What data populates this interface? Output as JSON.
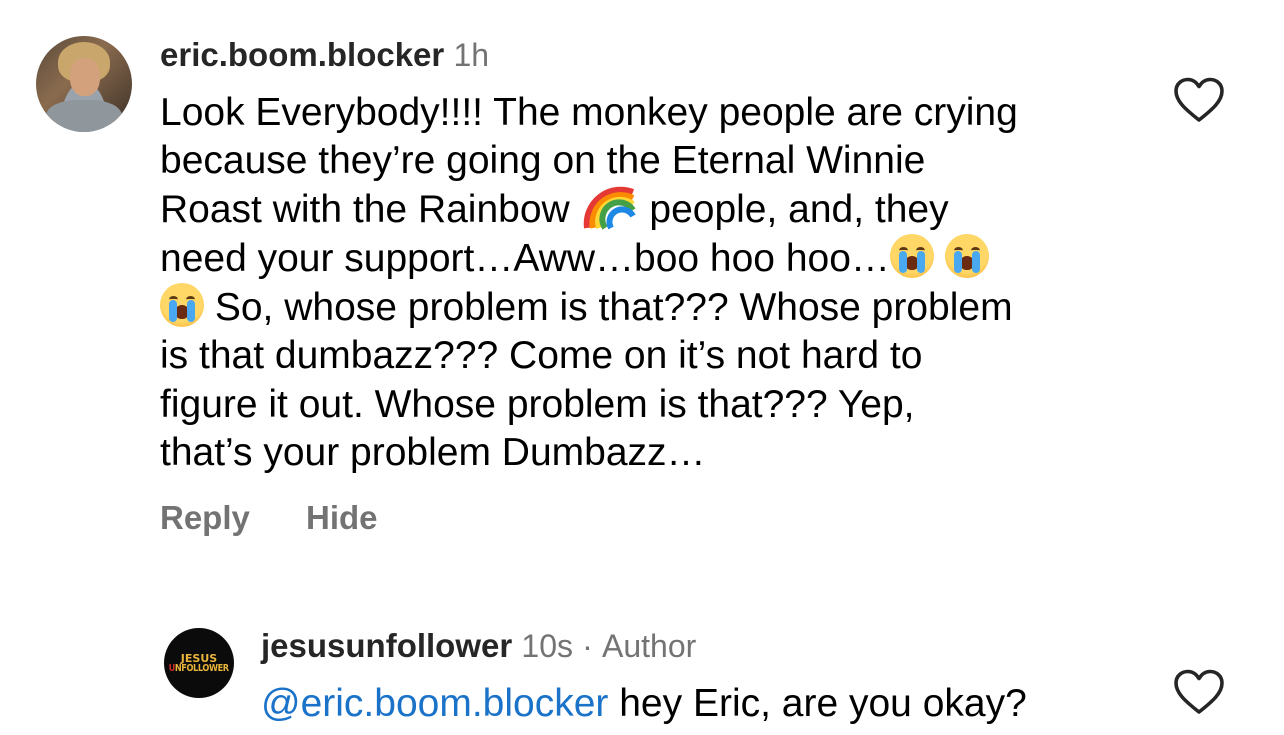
{
  "comments": [
    {
      "username": "eric.boom.blocker",
      "time": "1h",
      "lines": [
        "Look Everybody!!!! The monkey people are crying",
        "because they’re going on the Eternal Winnie",
        [
          "Roast with the Rainbow ",
          " people, and, they"
        ],
        "need your support…Aww…boo hoo hoo…",
        " So, whose problem is that??? Whose problem",
        "is that dumbazz??? Come on it’s not hard to",
        "figure it out. Whose problem is that??? Yep,",
        "that’s your problem Dumbazz…"
      ],
      "actions": {
        "reply": "Reply",
        "hide": "Hide"
      },
      "icons": {
        "avatar": "profile-photo",
        "like": "heart-outline-icon",
        "rainbow": "rainbow-emoji",
        "cry": "loudly-crying-face-emoji"
      }
    },
    {
      "username": "jesusunfollower",
      "time": "10s",
      "separator": "·",
      "badge": "Author",
      "mention": "@eric.boom.blocker",
      "text": " hey Eric, are you okay?",
      "avatar_logo": {
        "top": "JESUS",
        "bottom_first": "U",
        "bottom_rest": "NFOLLOWER"
      },
      "icons": {
        "like": "heart-outline-icon"
      }
    }
  ],
  "colors": {
    "username": "#262626",
    "meta": "#737373",
    "mention": "#1a73c8",
    "logo_gold": "#e8b43a",
    "logo_red": "#d12a2a"
  }
}
